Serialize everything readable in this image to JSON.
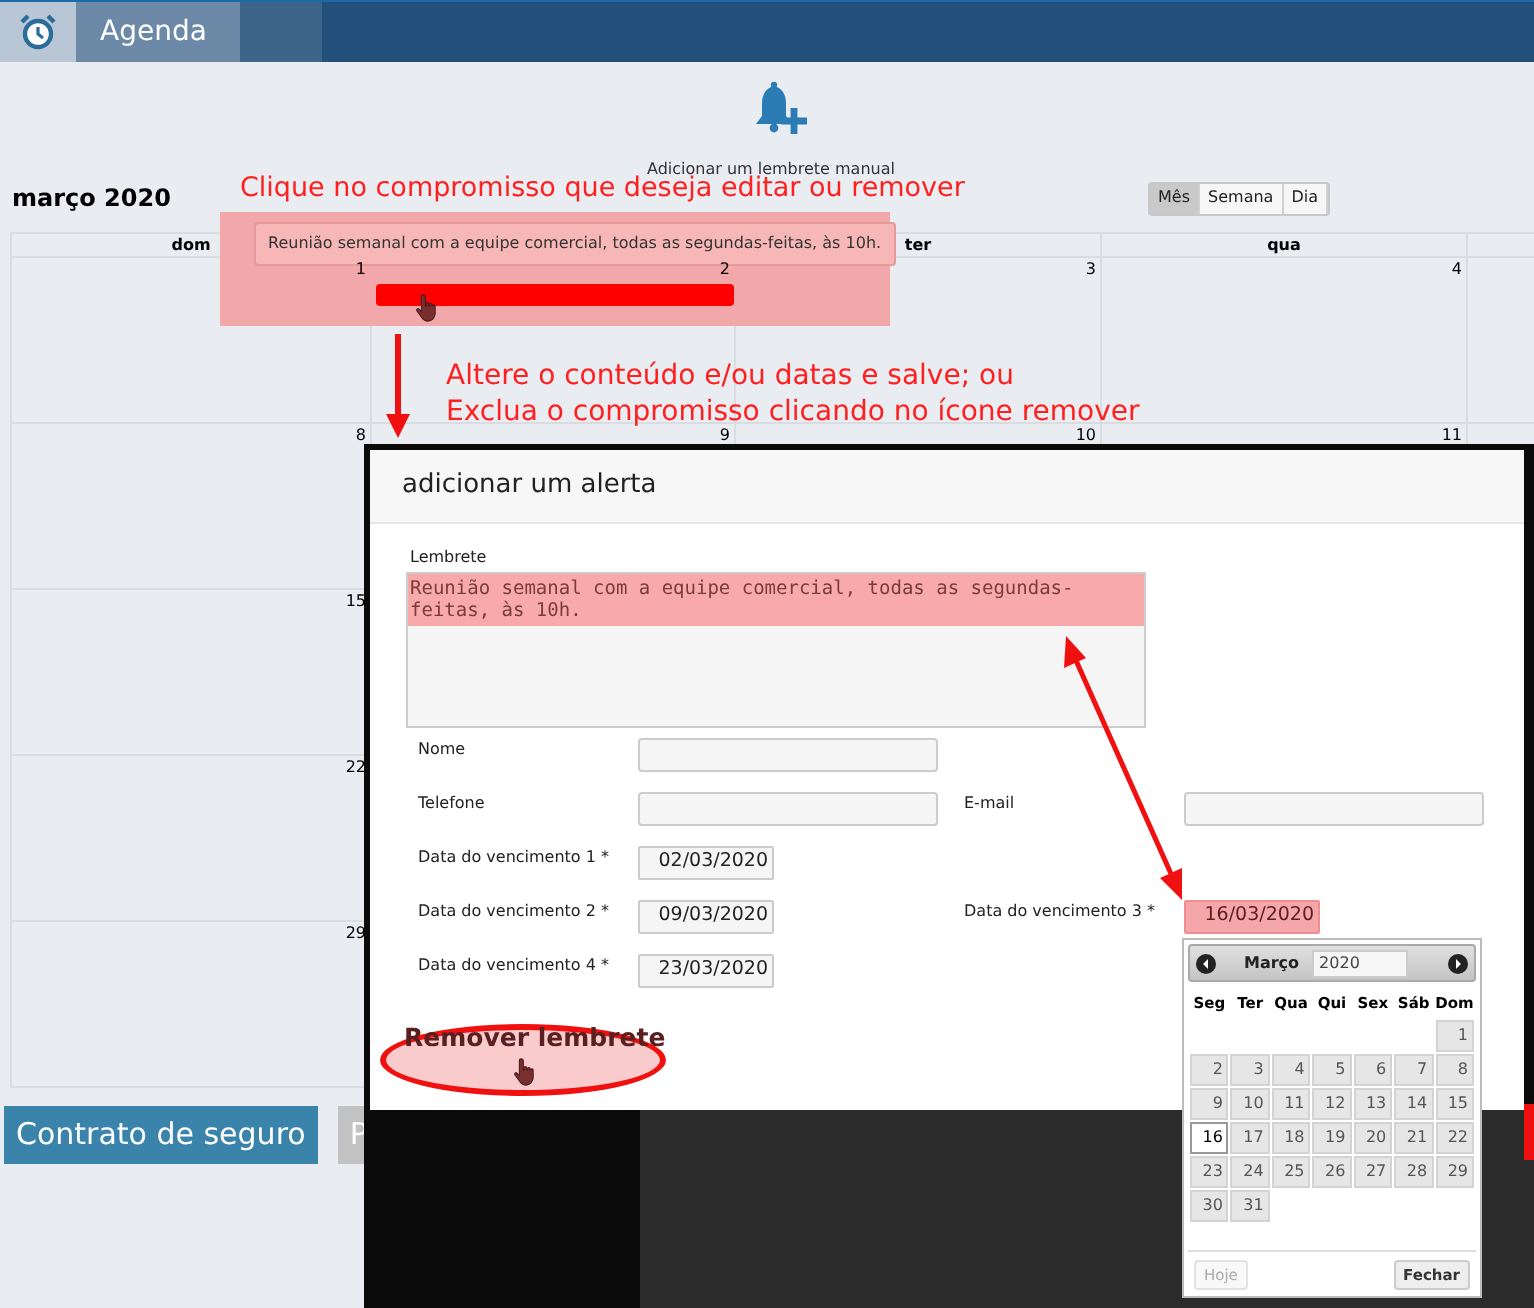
{
  "topbar": {
    "tabs": [
      {
        "label": "Agenda",
        "selected": true
      }
    ]
  },
  "add_reminder": {
    "label": "Adicionar um lembrete manual"
  },
  "calendar": {
    "title": "março 2020",
    "views": [
      {
        "label": "Mês",
        "selected": true
      },
      {
        "label": "Semana",
        "selected": false
      },
      {
        "label": "Dia",
        "selected": false
      }
    ],
    "columns": [
      "dom",
      "ter",
      "qua"
    ],
    "weeks": [
      [
        "1",
        "2",
        "3",
        "4"
      ],
      [
        "8",
        "9",
        "10",
        "11"
      ],
      [
        "15"
      ],
      [
        "22"
      ],
      [
        "29"
      ]
    ],
    "event": {
      "tooltip": "Reunião semanal com a equipe comercial, todas as segundas-feitas, às 10h.",
      "color": "#ff0000"
    }
  },
  "annotations": {
    "click_hint": "Clique no compromisso que deseja editar ou remover",
    "edit_hint": [
      "Altere o conteúdo e/ou datas e salve; ou",
      "Exclua o compromisso clicando no ícone remover"
    ]
  },
  "buttons": [
    {
      "label": "Contrato de seguro",
      "kind": "primary"
    },
    {
      "label": "P",
      "kind": "secondary"
    }
  ],
  "modal": {
    "title": "adicionar um alerta",
    "reminder": {
      "label": "Lembrete",
      "value": "Reunião semanal com a equipe comercial, todas as segundas-feitas, às 10h.",
      "highlighted": true
    },
    "rows": [
      [
        {
          "label": "Nome",
          "kind": "text"
        }
      ],
      [
        {
          "label": "Telefone",
          "kind": "text"
        },
        {
          "label": "E-mail",
          "kind": "text"
        }
      ],
      [
        {
          "label": "Data do vencimento 1 *",
          "kind": "date",
          "value": "02/03/2020",
          "highlighted": false
        }
      ],
      [
        {
          "label": "Data do vencimento 2 *",
          "kind": "date",
          "value": "09/03/2020",
          "highlighted": false
        },
        {
          "label": "Data do vencimento 3 *",
          "kind": "date",
          "value": "16/03/2020",
          "highlighted": true
        }
      ],
      [
        {
          "label": "Data do vencimento 4 *",
          "kind": "date",
          "value": "23/03/2020",
          "highlighted": false
        }
      ]
    ],
    "remove_button": {
      "label": "Remover lembrete"
    }
  },
  "datepicker": {
    "month": "Março",
    "year": "2020",
    "weekdays": [
      "Seg",
      "Ter",
      "Qua",
      "Qui",
      "Sex",
      "Sáb",
      "Dom"
    ],
    "weeks": [
      [
        {
          "kind": "empty"
        },
        {
          "kind": "empty"
        },
        {
          "kind": "empty"
        },
        {
          "kind": "empty"
        },
        {
          "kind": "empty"
        },
        {
          "kind": "empty"
        },
        {
          "label": "1",
          "selected": false
        }
      ],
      [
        {
          "label": "2",
          "selected": false
        },
        {
          "label": "3",
          "selected": false
        },
        {
          "label": "4",
          "selected": false
        },
        {
          "label": "5",
          "selected": false
        },
        {
          "label": "6",
          "selected": false
        },
        {
          "label": "7",
          "selected": false
        },
        {
          "label": "8",
          "selected": false
        }
      ],
      [
        {
          "label": "9",
          "selected": false
        },
        {
          "label": "10",
          "selected": false
        },
        {
          "label": "11",
          "selected": false
        },
        {
          "label": "12",
          "selected": false
        },
        {
          "label": "13",
          "selected": false
        },
        {
          "label": "14",
          "selected": false
        },
        {
          "label": "15",
          "selected": false
        }
      ],
      [
        {
          "label": "16",
          "selected": true
        },
        {
          "label": "17",
          "selected": false
        },
        {
          "label": "18",
          "selected": false
        },
        {
          "label": "19",
          "selected": false
        },
        {
          "label": "20",
          "selected": false
        },
        {
          "label": "21",
          "selected": false
        },
        {
          "label": "22",
          "selected": false
        }
      ],
      [
        {
          "label": "23",
          "selected": false
        },
        {
          "label": "24",
          "selected": false
        },
        {
          "label": "25",
          "selected": false
        },
        {
          "label": "26",
          "selected": false
        },
        {
          "label": "27",
          "selected": false
        },
        {
          "label": "28",
          "selected": false
        },
        {
          "label": "29",
          "selected": false
        }
      ],
      [
        {
          "label": "30",
          "selected": false
        },
        {
          "label": "31",
          "selected": false
        }
      ]
    ],
    "buttons": [
      {
        "label": "Hoje",
        "disabled": true
      },
      {
        "label": "Fechar",
        "disabled": false
      }
    ]
  }
}
